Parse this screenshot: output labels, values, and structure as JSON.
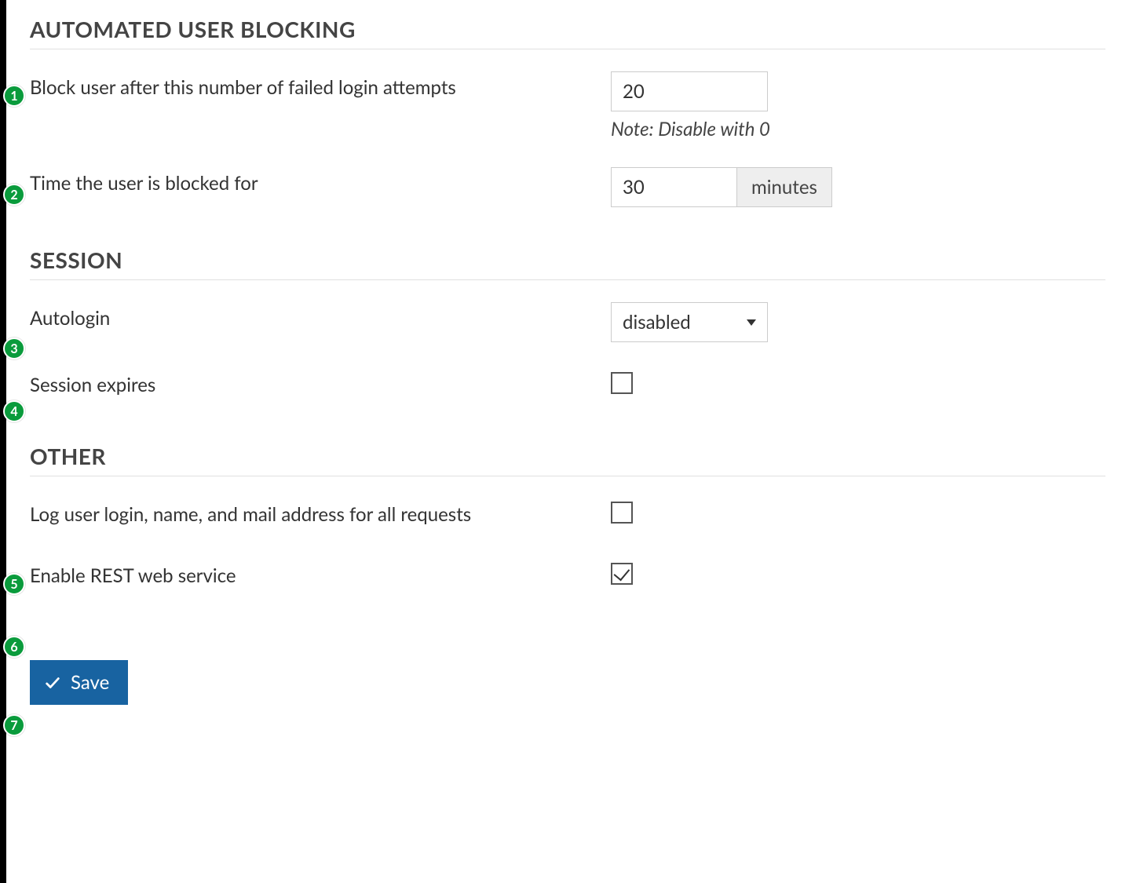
{
  "sections": {
    "blocking": {
      "title": "AUTOMATED USER BLOCKING",
      "failed_attempts": {
        "label": "Block user after this number of failed login attempts",
        "value": "20",
        "note": "Note: Disable with 0"
      },
      "block_time": {
        "label": "Time the user is blocked for",
        "value": "30",
        "unit": "minutes"
      }
    },
    "session": {
      "title": "SESSION",
      "autologin": {
        "label": "Autologin",
        "selected": "disabled"
      },
      "session_expires": {
        "label": "Session expires",
        "checked": false
      }
    },
    "other": {
      "title": "OTHER",
      "log_user": {
        "label": "Log user login, name, and mail address for all requests",
        "checked": false
      },
      "enable_rest": {
        "label": "Enable REST web service",
        "checked": true
      }
    }
  },
  "actions": {
    "save_label": "Save"
  },
  "markers": [
    "1",
    "2",
    "3",
    "4",
    "5",
    "6",
    "7"
  ]
}
